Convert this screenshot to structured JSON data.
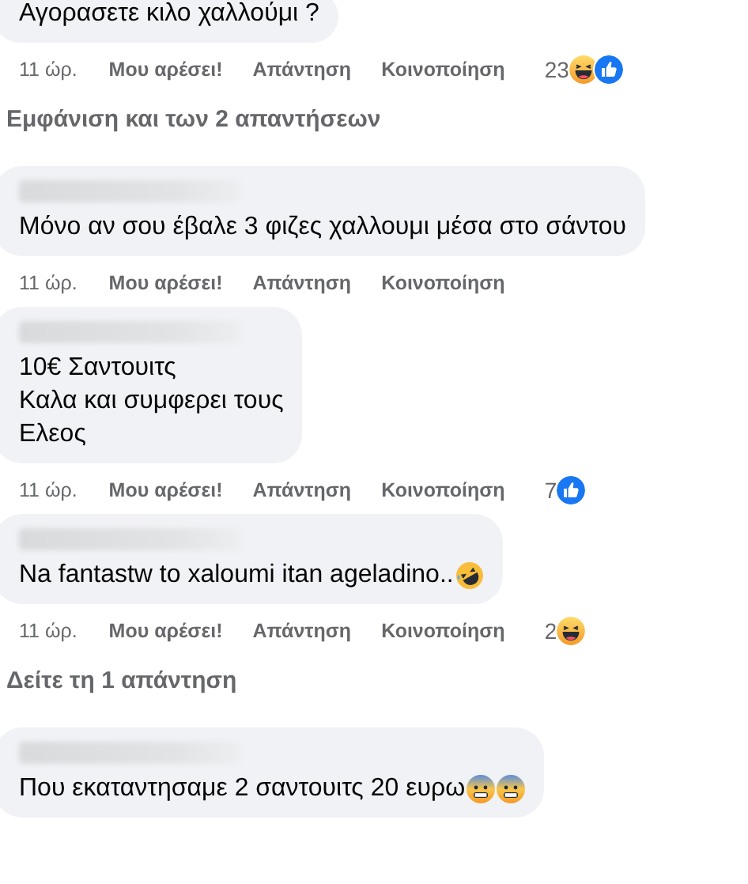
{
  "comments": [
    {
      "kind": "comment",
      "name_hidden": false,
      "lines": [
        "Αγορασετε κιλο χαλλούμι ?"
      ],
      "time": "11 ώρ.",
      "actions": [
        "Μου αρέσει!",
        "Απάντηση",
        "Κοινοποίηση"
      ],
      "reaction_count": "23",
      "reactions": [
        {
          "kind": "haha"
        },
        {
          "kind": "like"
        }
      ]
    },
    {
      "kind": "replies",
      "label": "Εμφάνιση και των 2 απαντήσεων"
    },
    {
      "kind": "comment",
      "name_hidden": true,
      "lines": [
        "Μόνο αν σου έβαλε 3 φιζες χαλλουμι μέσα στο σάντου"
      ],
      "time": "11 ώρ.",
      "actions": [
        "Μου αρέσει!",
        "Απάντηση",
        "Κοινοποίηση"
      ]
    },
    {
      "kind": "comment",
      "name_hidden": true,
      "lines": [
        "10€ Σαντουιτς",
        "Καλα και συμφερει τους",
        "Ελεος"
      ],
      "time": "11 ώρ.",
      "actions": [
        "Μου αρέσει!",
        "Απάντηση",
        "Κοινοποίηση"
      ],
      "reaction_count": "7",
      "reactions": [
        {
          "kind": "like"
        }
      ]
    },
    {
      "kind": "comment",
      "name_hidden": true,
      "lines": [
        "Na fantastw to xaloumi itan ageladino.."
      ],
      "emoji": [
        {
          "kind": "rofl"
        }
      ],
      "time": "11 ώρ.",
      "actions": [
        "Μου αρέσει!",
        "Απάντηση",
        "Κοινοποίηση"
      ],
      "reaction_count": "2",
      "reactions": [
        {
          "kind": "haha"
        }
      ]
    },
    {
      "kind": "replies",
      "label": "Δείτε τη 1 απάντηση"
    },
    {
      "kind": "comment",
      "name_hidden": true,
      "lines": [
        "Που εκαταντησαμε 2 σαντουιτς 20 ευρω"
      ],
      "emoji": [
        {
          "kind": "fearful"
        },
        {
          "kind": "fearful"
        }
      ]
    }
  ]
}
